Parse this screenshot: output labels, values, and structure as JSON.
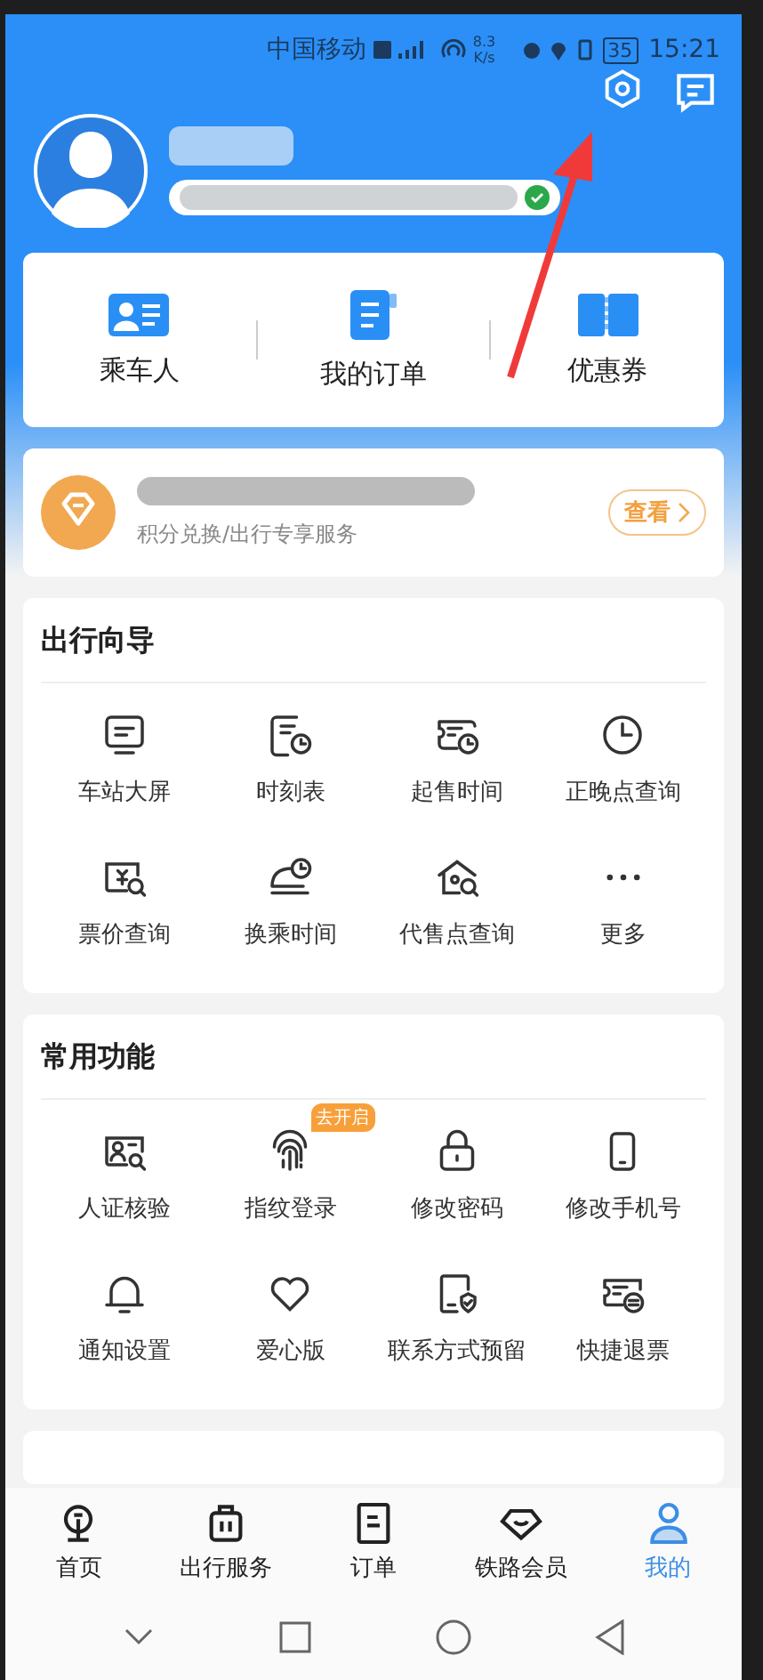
{
  "status_bar": {
    "carrier": "中国移动",
    "speed_value": "8.3",
    "speed_unit": "K/s",
    "battery": "35",
    "time": "15:21"
  },
  "quick_links": [
    {
      "label": "乘车人"
    },
    {
      "label": "我的订单"
    },
    {
      "label": "优惠券"
    }
  ],
  "points_card": {
    "subtitle": "积分兑换/出行专享服务",
    "button": "查看"
  },
  "guide": {
    "title": "出行向导",
    "items": [
      {
        "label": "车站大屏"
      },
      {
        "label": "时刻表"
      },
      {
        "label": "起售时间"
      },
      {
        "label": "正晚点查询"
      },
      {
        "label": "票价查询"
      },
      {
        "label": "换乘时间"
      },
      {
        "label": "代售点查询"
      },
      {
        "label": "更多"
      }
    ]
  },
  "common": {
    "title": "常用功能",
    "items": [
      {
        "label": "人证核验"
      },
      {
        "label": "指纹登录",
        "badge": "去开启"
      },
      {
        "label": "修改密码"
      },
      {
        "label": "修改手机号"
      },
      {
        "label": "通知设置"
      },
      {
        "label": "爱心版"
      },
      {
        "label": "联系方式预留"
      },
      {
        "label": "快捷退票"
      }
    ]
  },
  "tab_bar": [
    {
      "label": "首页",
      "selected": false
    },
    {
      "label": "出行服务",
      "selected": false
    },
    {
      "label": "订单",
      "selected": false
    },
    {
      "label": "铁路会员",
      "selected": false
    },
    {
      "label": "我的",
      "selected": true
    }
  ]
}
